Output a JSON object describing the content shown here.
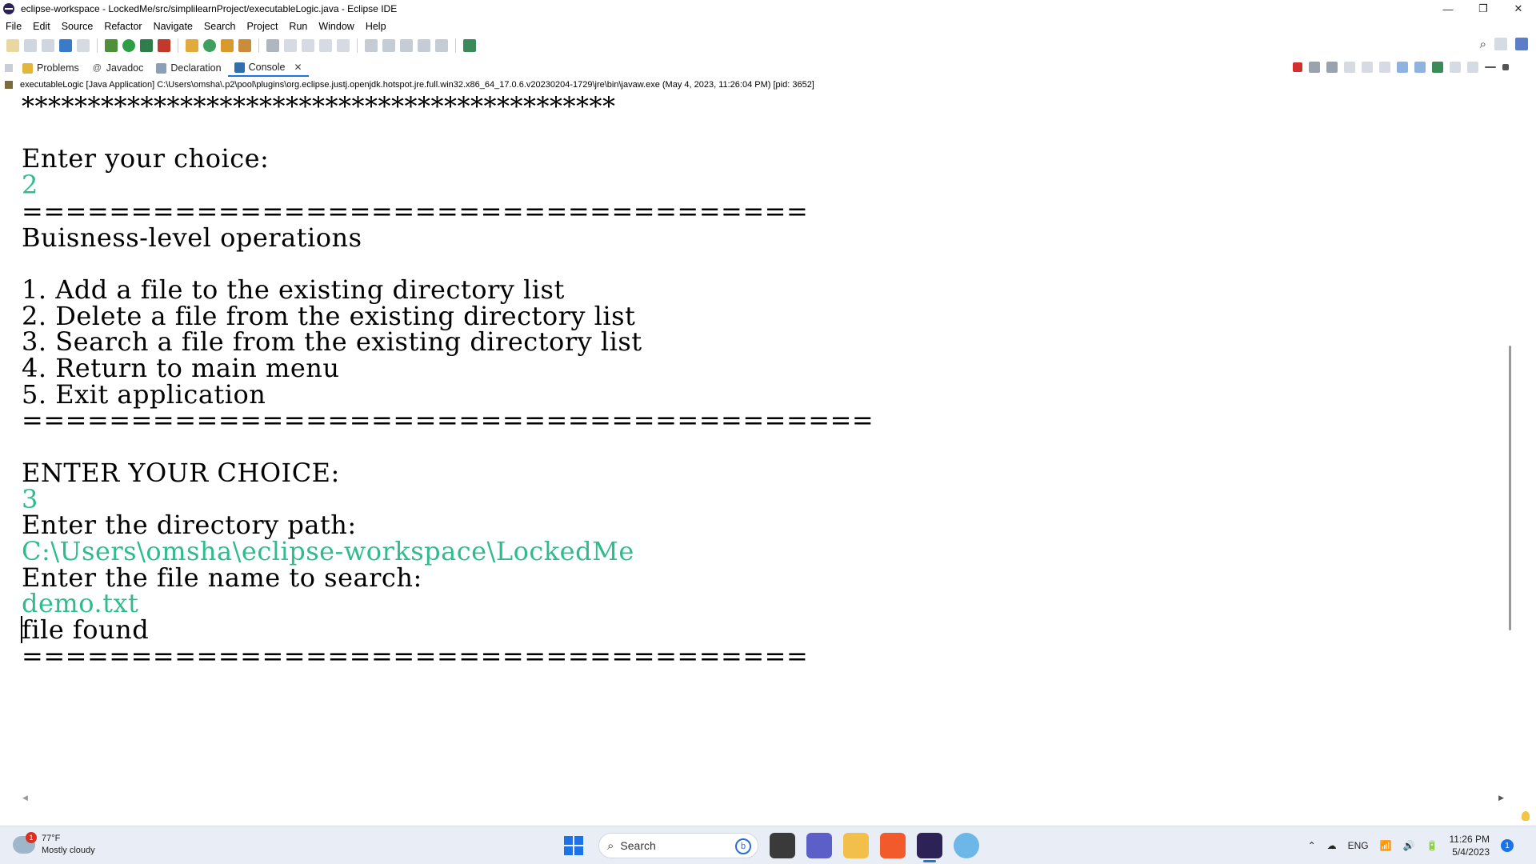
{
  "window": {
    "title": "eclipse-workspace - LockedMe/src/simplilearnProject/executableLogic.java - Eclipse IDE",
    "minimize_glyph": "—",
    "restore_glyph": "❐",
    "close_glyph": "✕"
  },
  "menu": [
    "File",
    "Edit",
    "Source",
    "Refactor",
    "Navigate",
    "Search",
    "Project",
    "Run",
    "Window",
    "Help"
  ],
  "tabs": [
    {
      "label": "Problems",
      "icon": "problems-icon"
    },
    {
      "label": "Javadoc",
      "icon": "javadoc-icon"
    },
    {
      "label": "Declaration",
      "icon": "declaration-icon"
    },
    {
      "label": "Console",
      "icon": "console-icon",
      "active": true
    }
  ],
  "console": {
    "process_line": "executableLogic [Java Application] C:\\Users\\omsha\\.p2\\pool\\plugins\\org.eclipse.justj.openjdk.hotspot.jre.full.win32.x86_64_17.0.6.v20230204-1729\\jre\\bin\\javaw.exe  (May 4, 2023, 11:26:04 PM) [pid: 3652]",
    "lines": [
      {
        "text": "*********************************************",
        "input": false
      },
      {
        "text": "",
        "input": false
      },
      {
        "text": "Enter your choice:",
        "input": false
      },
      {
        "text": "2",
        "input": true
      },
      {
        "text": "====================================",
        "input": false
      },
      {
        "text": "Buisness-level operations",
        "input": false
      },
      {
        "text": "",
        "input": false
      },
      {
        "text": "1. Add a file to the existing directory list",
        "input": false
      },
      {
        "text": "2. Delete a file from the existing directory list",
        "input": false
      },
      {
        "text": "3. Search a file from the existing directory list",
        "input": false
      },
      {
        "text": "4. Return to main menu",
        "input": false
      },
      {
        "text": "5. Exit application",
        "input": false
      },
      {
        "text": "=======================================",
        "input": false
      },
      {
        "text": "",
        "input": false
      },
      {
        "text": "ENTER YOUR CHOICE:",
        "input": false
      },
      {
        "text": "3",
        "input": true
      },
      {
        "text": "Enter the directory path:",
        "input": false
      },
      {
        "text": "C:\\Users\\omsha\\eclipse-workspace\\LockedMe",
        "input": true
      },
      {
        "text": "Enter the file name to search:",
        "input": false
      },
      {
        "text": "demo.txt",
        "input": true
      },
      {
        "text": "file found",
        "input": false
      },
      {
        "text": "====================================",
        "input": false
      }
    ]
  },
  "taskbar": {
    "weather_temp": "77°F",
    "weather_desc": "Mostly cloudy",
    "weather_badge": "1",
    "search_placeholder": "Search",
    "tray_lang": "ENG",
    "time": "11:26 PM",
    "date": "5/4/2023",
    "notification_count": "1"
  },
  "colors": {
    "console_input": "#2ebc8c",
    "accent": "#1a73e8"
  }
}
